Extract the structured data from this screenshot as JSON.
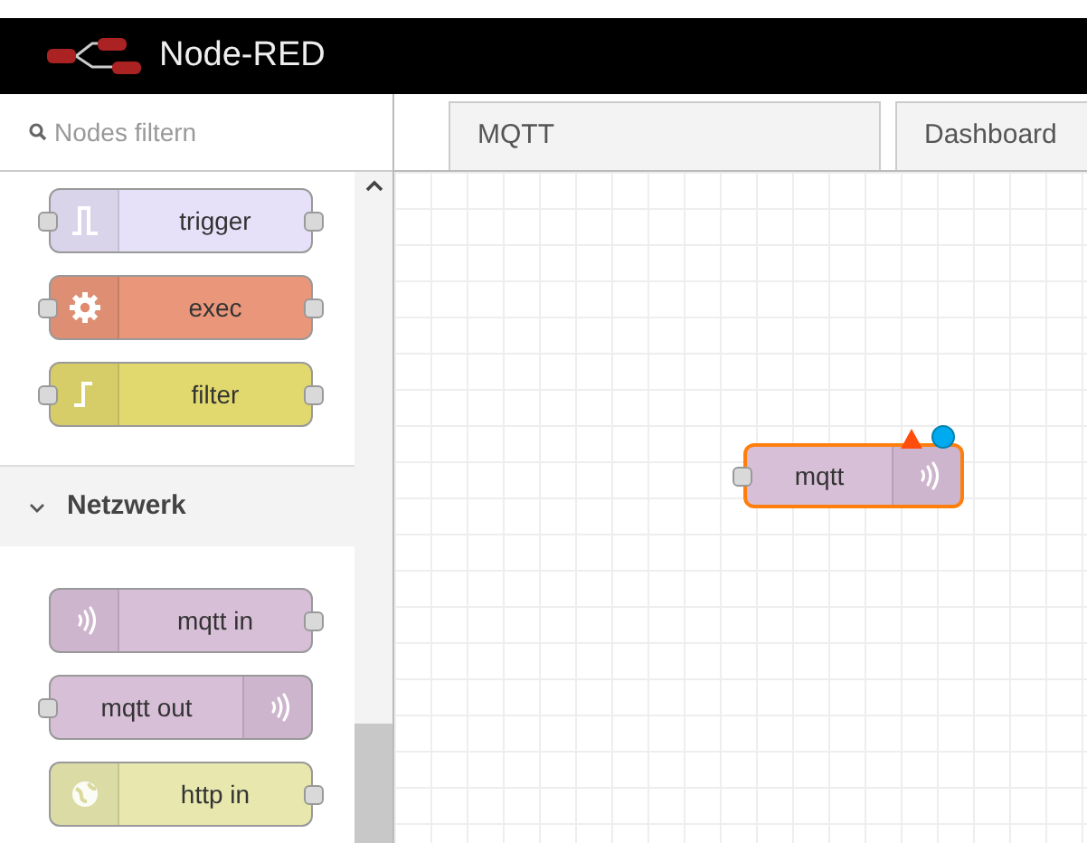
{
  "app": {
    "title": "Node-RED"
  },
  "search": {
    "placeholder": "Nodes filtern"
  },
  "tabs": [
    {
      "label": "MQTT"
    },
    {
      "label": "Dashboard"
    }
  ],
  "palette": {
    "nodes": [
      {
        "label": "trigger",
        "kind": "pulse",
        "color": "#e6e0f8",
        "input": true,
        "output": true
      },
      {
        "label": "exec",
        "kind": "gear",
        "color": "#e9967a",
        "input": true,
        "output": true
      },
      {
        "label": "filter",
        "kind": "filter",
        "color": "#e2d96e",
        "input": true,
        "output": true
      }
    ],
    "categories": [
      {
        "label": "Netzwerk",
        "expanded": true,
        "nodes": [
          {
            "label": "mqtt in",
            "kind": "waves",
            "color": "#d8bfd8",
            "input": false,
            "output": true
          },
          {
            "label": "mqtt out",
            "kind": "waves",
            "color": "#d8bfd8",
            "input": true,
            "output": false
          },
          {
            "label": "http in",
            "kind": "globe",
            "color": "#e7e7ae",
            "input": false,
            "output": true
          }
        ]
      }
    ]
  },
  "canvas": {
    "nodes": [
      {
        "label": "mqtt",
        "kind": "waves",
        "color": "#d8bfd8",
        "input": true,
        "output": false,
        "selected": true,
        "invalid": true,
        "changed": true
      }
    ]
  }
}
